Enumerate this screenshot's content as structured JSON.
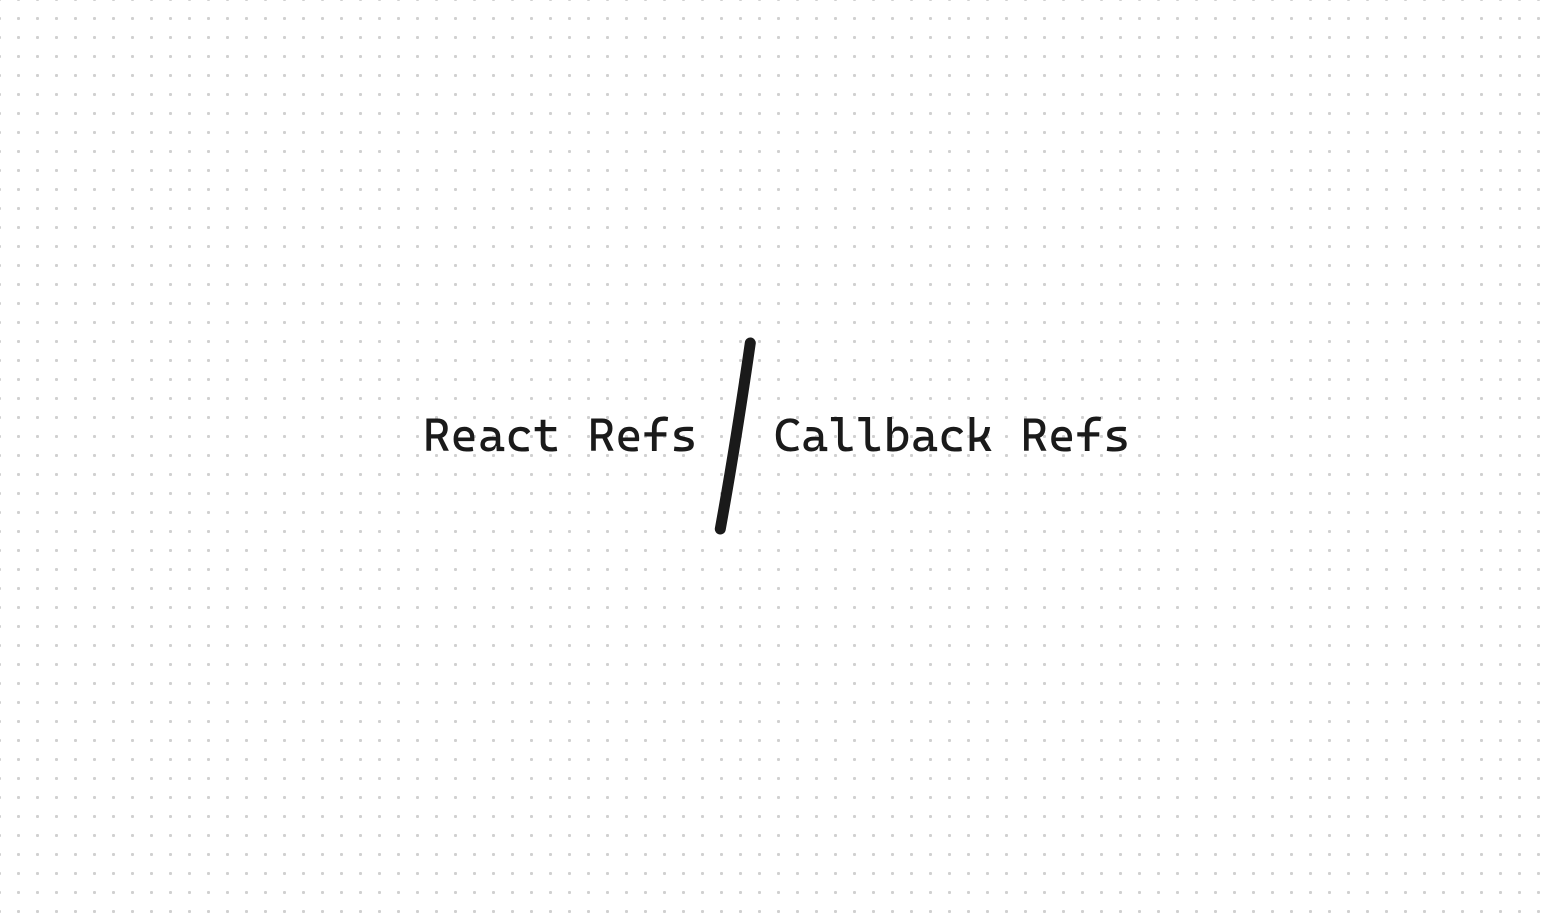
{
  "canvas": {
    "text_left": "React Refs",
    "text_right": "Callback Refs",
    "divider_stroke": "#1a1a1a"
  }
}
